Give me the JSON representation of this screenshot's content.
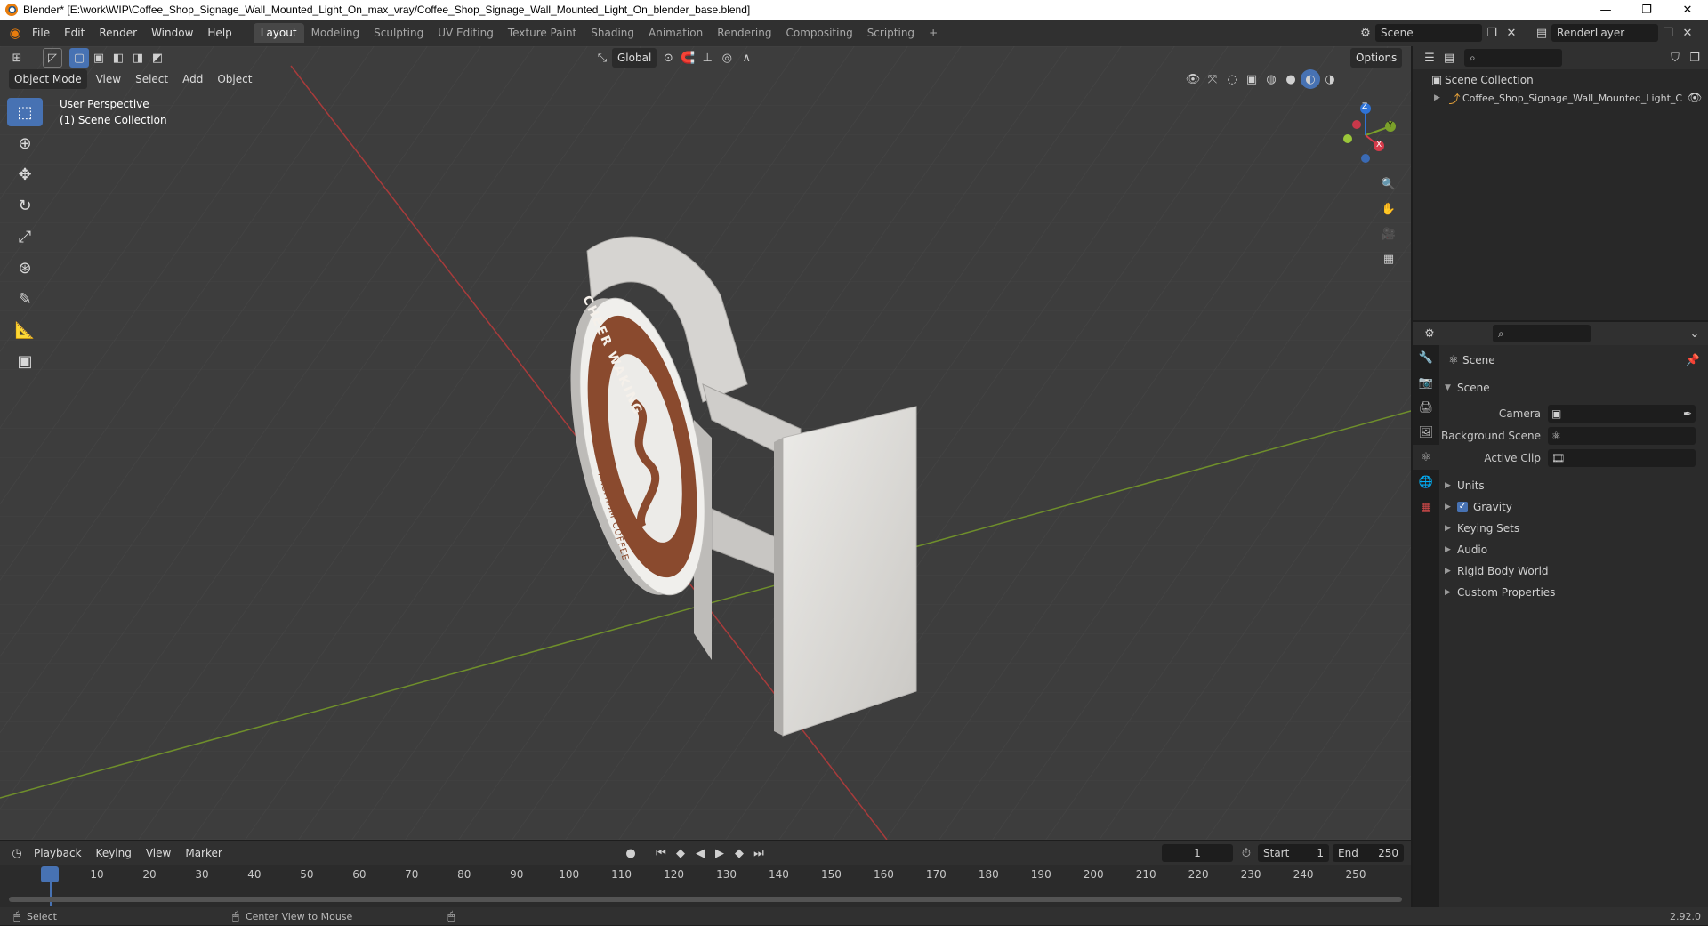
{
  "window": {
    "title": "Blender* [E:\\work\\WIP\\Coffee_Shop_Signage_Wall_Mounted_Light_On_max_vray/Coffee_Shop_Signage_Wall_Mounted_Light_On_blender_base.blend]",
    "minimize": "—",
    "maximize": "❐",
    "close": "✕"
  },
  "menu": [
    "File",
    "Edit",
    "Render",
    "Window",
    "Help"
  ],
  "workspaces": [
    "Layout",
    "Modeling",
    "Sculpting",
    "UV Editing",
    "Texture Paint",
    "Shading",
    "Animation",
    "Rendering",
    "Compositing",
    "Scripting"
  ],
  "workspace_add": "+",
  "scene_name": "Scene",
  "view_layer": "RenderLayer",
  "viewport": {
    "mode": "Object Mode",
    "menus": [
      "View",
      "Select",
      "Add",
      "Object"
    ],
    "transform_orientation": "Global",
    "options_label": "Options",
    "perspective": "User Perspective",
    "collection": "(1) Scene Collection",
    "gizmo": {
      "x": "X",
      "y": "Y",
      "z": "Z"
    }
  },
  "sign": {
    "brand_top": "CHEER WAKING",
    "brand_bottom": "PREMIUM COFFEE",
    "colors": {
      "ring": "#8a4a2e",
      "panel": "#e8e6e2",
      "bracket": "#cfcdca"
    }
  },
  "outliner": {
    "root": "Scene Collection",
    "item": "Coffee_Shop_Signage_Wall_Mounted_Light_C"
  },
  "properties": {
    "context": "Scene",
    "section": "Scene",
    "camera_label": "Camera",
    "background_scene_label": "Background Scene",
    "active_clip_label": "Active Clip",
    "subsections": [
      "Units",
      "Gravity",
      "Keying Sets",
      "Audio",
      "Rigid Body World",
      "Custom Properties"
    ],
    "gravity_checked": true
  },
  "timeline": {
    "menus": [
      "Playback",
      "Keying",
      "View",
      "Marker"
    ],
    "current_frame": "1",
    "start_label": "Start",
    "start": "1",
    "end_label": "End",
    "end": "250",
    "ticks": [
      "1",
      "10",
      "20",
      "30",
      "40",
      "50",
      "60",
      "70",
      "80",
      "90",
      "100",
      "110",
      "120",
      "130",
      "140",
      "150",
      "160",
      "170",
      "180",
      "190",
      "200",
      "210",
      "220",
      "230",
      "240",
      "250"
    ]
  },
  "status": {
    "select": "Select",
    "center_view": "Center View to Mouse",
    "version": "2.92.0"
  }
}
